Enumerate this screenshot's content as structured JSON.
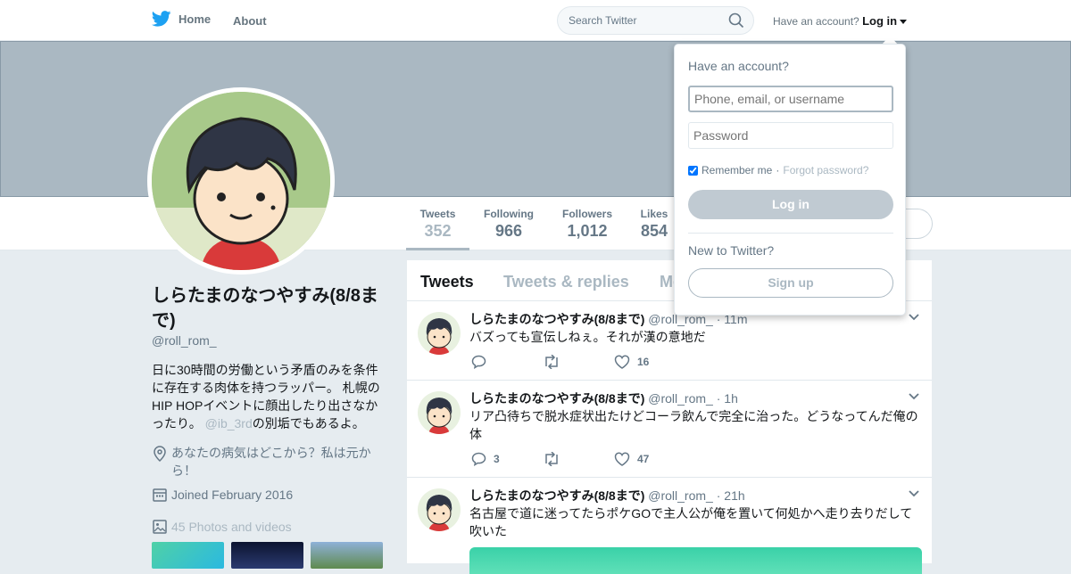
{
  "topbar": {
    "home_label": "Home",
    "about_label": "About",
    "search_placeholder": "Search Twitter",
    "have_account": "Have an account?",
    "login_label": "Log in"
  },
  "profile_nav": {
    "stats": [
      {
        "label": "Tweets",
        "value": "352"
      },
      {
        "label": "Following",
        "value": "966"
      },
      {
        "label": "Followers",
        "value": "1,012"
      },
      {
        "label": "Likes",
        "value": "854"
      }
    ]
  },
  "profile": {
    "name": "しらたまのなつやすみ(8/8まで)",
    "handle": "@roll_rom_",
    "bio_pre": "日に30時間の労働という矛盾のみを条件に存在する肉体を持つラッパー。 札幌のHIP HOPイベントに顔出したり出さなかったり。",
    "bio_mention": "@ib_3rd",
    "bio_post": "の別垢でもあるよ。",
    "location": "あなたの病気はどこから？私は元から！",
    "joined": "Joined February 2016",
    "photos": "45 Photos and videos"
  },
  "timeline": {
    "tabs": [
      "Tweets",
      "Tweets & replies",
      "Media"
    ],
    "tweets": [
      {
        "name": "しらたまのなつやすみ(8/8まで)",
        "handle": "@roll_rom_",
        "time": "11m",
        "text": "バズっても宣伝しねぇ。それが漢の意地だ",
        "replies": "",
        "retweets": "",
        "likes": "16"
      },
      {
        "name": "しらたまのなつやすみ(8/8まで)",
        "handle": "@roll_rom_",
        "time": "1h",
        "text": "リア凸待ちで脱水症状出たけどコーラ飲んで完全に治った。どうなってんだ俺の体",
        "replies": "3",
        "retweets": "",
        "likes": "47"
      },
      {
        "name": "しらたまのなつやすみ(8/8まで)",
        "handle": "@roll_rom_",
        "time": "21h",
        "text": "名古屋で道に迷ってたらポケGOで主人公が俺を置いて何処かへ走り去りだして吹いた",
        "replies": "",
        "retweets": "",
        "likes": ""
      }
    ]
  },
  "login_dropdown": {
    "title": "Have an account?",
    "username_placeholder": "Phone, email, or username",
    "password_placeholder": "Password",
    "remember_me": "Remember me",
    "separator": "·",
    "forgot": "Forgot password?",
    "login_button": "Log in",
    "new_to": "New to Twitter?",
    "signup_button": "Sign up"
  },
  "colors": {
    "brand": "#1da1f2",
    "banner": "#aab8c2",
    "muted": "#657786"
  }
}
